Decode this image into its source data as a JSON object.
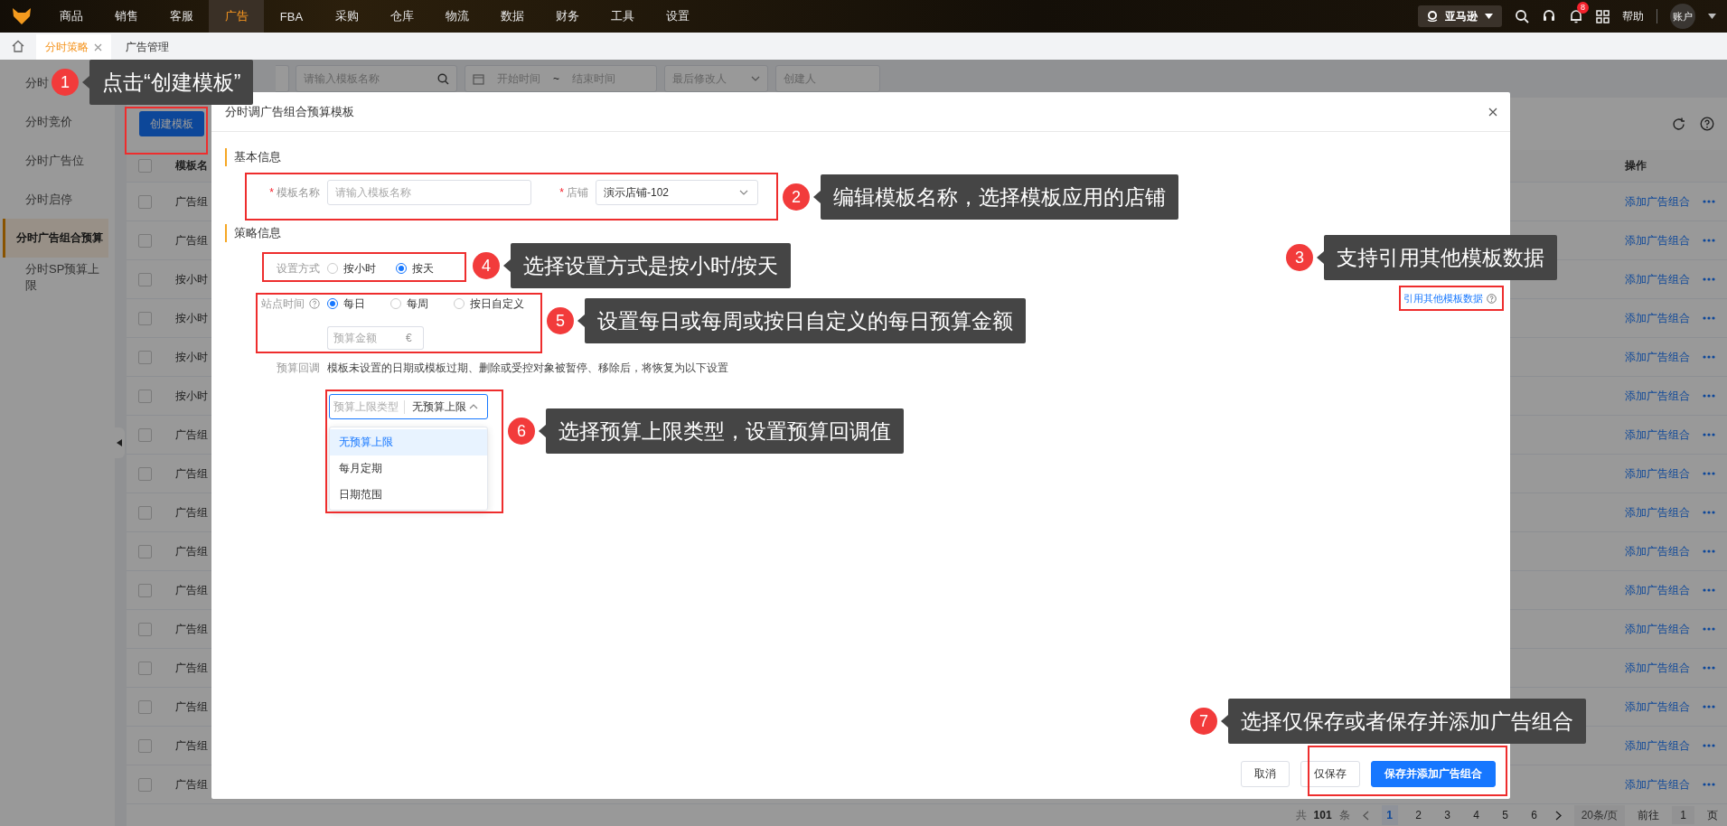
{
  "nav": {
    "items": [
      {
        "label": "商品",
        "selected": false
      },
      {
        "label": "销售",
        "selected": false
      },
      {
        "label": "客服",
        "selected": false
      },
      {
        "label": "广告",
        "selected": true
      },
      {
        "label": "FBA",
        "selected": false
      },
      {
        "label": "采购",
        "selected": false
      },
      {
        "label": "仓库",
        "selected": false
      },
      {
        "label": "物流",
        "selected": false
      },
      {
        "label": "数据",
        "selected": false
      },
      {
        "label": "财务",
        "selected": false
      },
      {
        "label": "工具",
        "selected": false
      },
      {
        "label": "设置",
        "selected": false
      }
    ],
    "platform": "亚马逊",
    "notifications": "8",
    "help": "帮助",
    "account": "账户"
  },
  "tabs": [
    {
      "label": "分时策略",
      "selected": true,
      "closable": true
    },
    {
      "label": "广告管理",
      "selected": false,
      "closable": false
    }
  ],
  "sidebar": {
    "items": [
      {
        "label": "分时",
        "selected": false
      },
      {
        "label": "分时竞价",
        "selected": false
      },
      {
        "label": "分时广告位",
        "selected": false
      },
      {
        "label": "分时启停",
        "selected": false
      },
      {
        "label": "分时广告组合预算",
        "selected": true
      },
      {
        "label": "分时SP预算上限",
        "selected": false
      }
    ]
  },
  "filters": {
    "search_placeholder": "请输入模板名称",
    "start_placeholder": "开始时间",
    "range_separator": "~",
    "end_placeholder": "结束时间",
    "modifier_placeholder": "最后修改人",
    "creator_placeholder": "创建人"
  },
  "create_button": "创建模板",
  "table": {
    "columns": [
      "模板名",
      "操作"
    ],
    "all_checked": false,
    "rows": [
      {
        "checked": false,
        "name": "广告组",
        "action": "添加广告组合"
      },
      {
        "checked": false,
        "name": "广告组",
        "action": "添加广告组合"
      },
      {
        "checked": false,
        "name": "按小时",
        "action": "添加广告组合"
      },
      {
        "checked": false,
        "name": "按小时",
        "action": "添加广告组合"
      },
      {
        "checked": false,
        "name": "按小时",
        "action": "添加广告组合"
      },
      {
        "checked": false,
        "name": "按小时",
        "action": "添加广告组合"
      },
      {
        "checked": false,
        "name": "广告组",
        "action": "添加广告组合"
      },
      {
        "checked": false,
        "name": "广告组",
        "action": "添加广告组合"
      },
      {
        "checked": false,
        "name": "广告组",
        "action": "添加广告组合"
      },
      {
        "checked": false,
        "name": "广告组",
        "action": "添加广告组合"
      },
      {
        "checked": false,
        "name": "广告组",
        "action": "添加广告组合"
      },
      {
        "checked": false,
        "name": "广告组",
        "action": "添加广告组合"
      },
      {
        "checked": false,
        "name": "广告组",
        "action": "添加广告组合"
      },
      {
        "checked": false,
        "name": "广告组",
        "action": "添加广告组合"
      },
      {
        "checked": false,
        "name": "广告组",
        "action": "添加广告组合"
      },
      {
        "checked": false,
        "name": "广告组",
        "action": "添加广告组合"
      }
    ]
  },
  "pagination": {
    "total_prefix": "共",
    "total": "101",
    "total_suffix": "条",
    "pages": [
      {
        "label": "1",
        "selected": true
      },
      {
        "label": "2",
        "selected": false
      },
      {
        "label": "3",
        "selected": false
      },
      {
        "label": "4",
        "selected": false
      },
      {
        "label": "5",
        "selected": false
      },
      {
        "label": "6",
        "selected": false
      }
    ],
    "page_size": "20条/页",
    "goto_label": "前往",
    "goto_value": "1",
    "goto_suffix": "页"
  },
  "modal": {
    "title": "分时调广告组合预算模板",
    "basic_title": "基本信息",
    "template_name": {
      "required_mark": "*",
      "label": "模板名称",
      "placeholder": "请输入模板名称"
    },
    "store": {
      "required_mark": "*",
      "label": "店铺",
      "value": "演示店铺-102"
    },
    "strategy_title": "策略信息",
    "setting_mode": {
      "label": "设置方式",
      "options": [
        {
          "label": "按小时",
          "selected": false
        },
        {
          "label": "按天",
          "selected": true
        }
      ]
    },
    "site_time": {
      "label": "站点时间",
      "options": [
        {
          "label": "每日",
          "selected": true
        },
        {
          "label": "每周",
          "selected": false
        },
        {
          "label": "按日自定义",
          "selected": false
        }
      ]
    },
    "budget": {
      "placeholder": "预算金额",
      "currency": "€"
    },
    "reference_link": "引用其他模板数据",
    "fallback": {
      "label": "预算回调",
      "text": "模板未设置的日期或模板过期、删除或受控对象被暂停、移除后，将恢复为以下设置"
    },
    "cap_select": {
      "prefix": "预算上限类型",
      "value": "无预算上限",
      "expanded": true,
      "options": [
        {
          "label": "无预算上限",
          "selected": true
        },
        {
          "label": "每月定期",
          "selected": false
        },
        {
          "label": "日期范围",
          "selected": false
        }
      ]
    },
    "buttons": [
      {
        "label": "取消",
        "kind": "default"
      },
      {
        "label": "仅保存",
        "kind": "default"
      },
      {
        "label": "保存并添加广告组合",
        "kind": "primary"
      }
    ]
  },
  "annotations": [
    {
      "number": "1",
      "text": "点击“创建模板”"
    },
    {
      "number": "2",
      "text": "编辑模板名称，选择模板应用的店铺"
    },
    {
      "number": "4",
      "text": "选择设置方式是按小时/按天"
    },
    {
      "number": "3",
      "text": "支持引用其他模板数据"
    },
    {
      "number": "5",
      "text": "设置每日或每周或按日自定义的每日预算金额"
    },
    {
      "number": "6",
      "text": "选择预算上限类型，设置预算回调值"
    },
    {
      "number": "7",
      "text": "选择仅保存或者保存并添加广告组合"
    }
  ]
}
